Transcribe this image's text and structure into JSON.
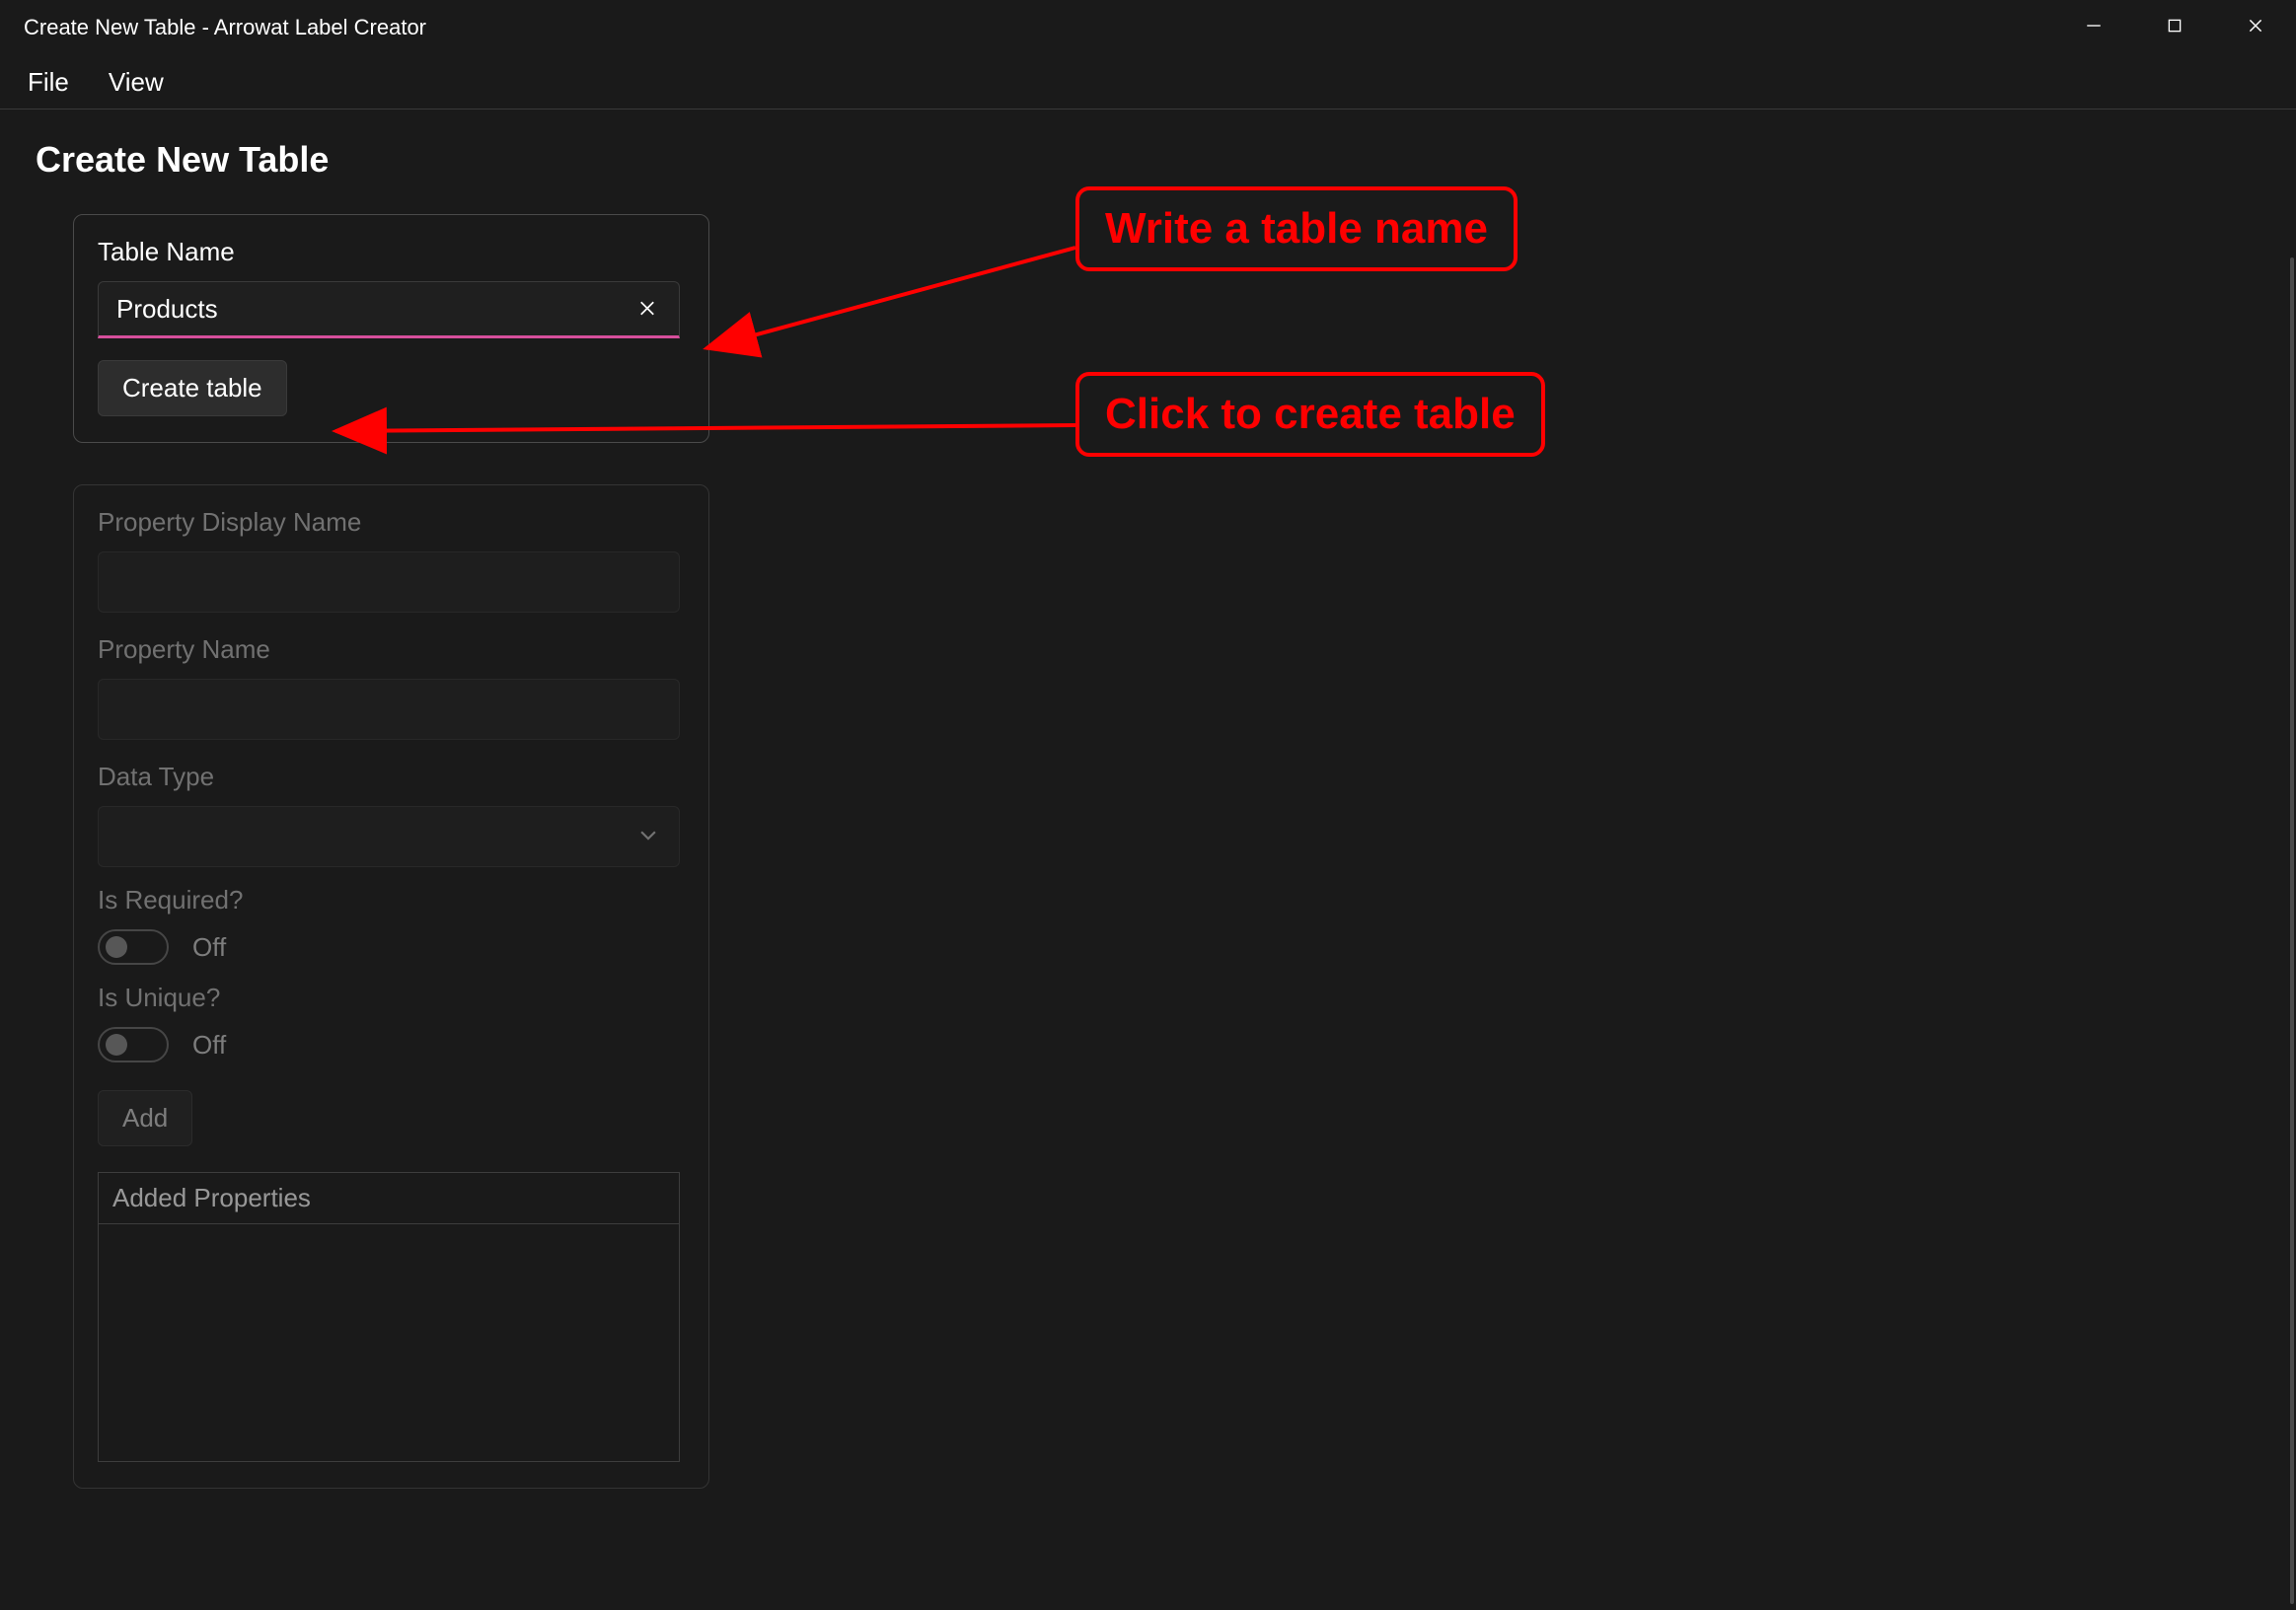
{
  "window": {
    "title": "Create New Table - Arrowat Label Creator"
  },
  "menu": {
    "file": "File",
    "view": "View"
  },
  "page": {
    "heading": "Create New Table"
  },
  "tableName": {
    "label": "Table Name",
    "value": "Products",
    "createButton": "Create table"
  },
  "property": {
    "displayNameLabel": "Property Display Name",
    "displayNameValue": "",
    "nameLabel": "Property Name",
    "nameValue": "",
    "dataTypeLabel": "Data Type",
    "dataTypeValue": "",
    "isRequiredLabel": "Is Required?",
    "isRequiredState": "Off",
    "isUniqueLabel": "Is Unique?",
    "isUniqueState": "Off",
    "addButton": "Add",
    "addedHeader": "Added Properties"
  },
  "annotations": {
    "writeName": "Write a table name",
    "clickCreate": "Click to create table"
  },
  "colors": {
    "accentUnderline": "#d64f9c",
    "annotationRed": "#ff0000"
  }
}
